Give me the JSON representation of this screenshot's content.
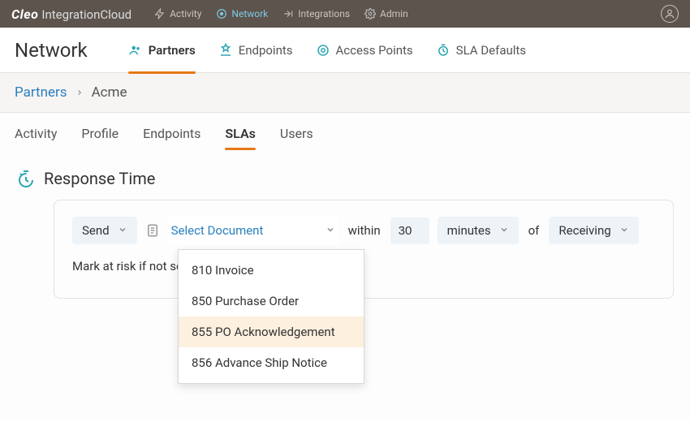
{
  "brand": {
    "cleo": "Cleo",
    "integrationcloud": "IntegrationCloud"
  },
  "topnav": {
    "activity": "Activity",
    "network": "Network",
    "integrations": "Integrations",
    "admin": "Admin"
  },
  "section": {
    "title": "Network",
    "tabs": {
      "partners": "Partners",
      "endpoints": "Endpoints",
      "access_points": "Access Points",
      "sla_defaults": "SLA Defaults"
    }
  },
  "breadcrumb": {
    "parent": "Partners",
    "current": "Acme"
  },
  "inner_tabs": {
    "activity": "Activity",
    "profile": "Profile",
    "endpoints": "Endpoints",
    "slas": "SLAs",
    "users": "Users"
  },
  "response_time": {
    "heading": "Response Time",
    "rule": {
      "action": "Send",
      "document_placeholder": "Select Document",
      "within": "within",
      "value": "30",
      "unit": "minutes",
      "of": "of",
      "trigger": "Receiving"
    },
    "mark_text_partial": "Mark at risk if not se",
    "dropdown_options": [
      "810 Invoice",
      "850 Purchase Order",
      "855 PO Acknowledgement",
      "856 Advance Ship Notice"
    ],
    "dropdown_highlight_index": 2
  }
}
